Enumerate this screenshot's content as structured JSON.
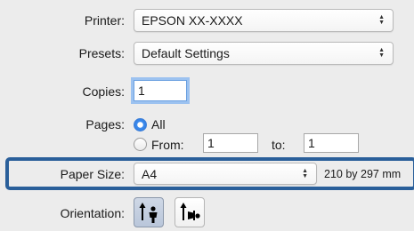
{
  "printer": {
    "label": "Printer:",
    "value": "EPSON XX-XXXX"
  },
  "presets": {
    "label": "Presets:",
    "value": "Default Settings"
  },
  "copies": {
    "label": "Copies:",
    "value": "1"
  },
  "pages": {
    "label": "Pages:",
    "all_label": "All",
    "from_label": "From:",
    "from_value": "1",
    "to_label": "to:",
    "to_value": "1",
    "selected": "All"
  },
  "paper_size": {
    "label": "Paper Size:",
    "value": "A4",
    "dimensions": "210 by 297 mm"
  },
  "orientation": {
    "label": "Orientation:",
    "options": [
      "portrait-icon",
      "landscape-icon"
    ],
    "selected": "portrait"
  },
  "colors": {
    "highlight_border": "#2a5f9a",
    "focus_ring": "#9cc2f0",
    "radio_selected": "#3f8ef0"
  }
}
